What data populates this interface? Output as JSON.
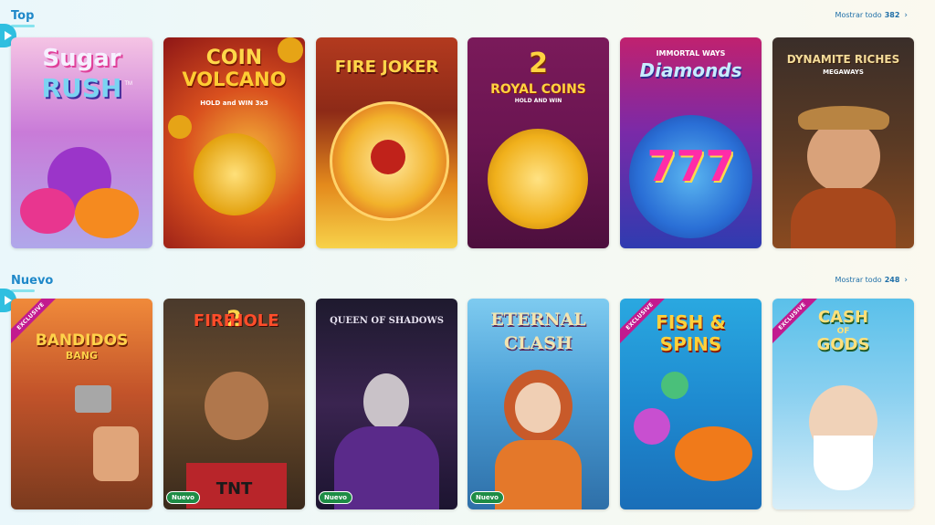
{
  "sections": {
    "top": {
      "title": "Top",
      "show_all_label": "Mostrar todo",
      "count": "382",
      "games": [
        {
          "title1": "Sugar",
          "title2": "RUSH",
          "tm": "TM"
        },
        {
          "title1": "COIN",
          "title2": "VOLCANO",
          "sub": "HOLD and WIN 3x3"
        },
        {
          "title1": "FIRE JOKER"
        },
        {
          "num": "2",
          "title1": "ROYAL COINS",
          "sub": "HOLD AND WIN"
        },
        {
          "title1": "IMMORTAL WAYS",
          "title2": "Diamonds",
          "sevens": "777"
        },
        {
          "title1": "DYNAMITE RICHES",
          "sub": "MEGAWAYS"
        }
      ]
    },
    "new": {
      "title": "Nuevo",
      "show_all_label": "Mostrar todo",
      "count": "248",
      "badge_exclusive": "EXCLUSIVE",
      "badge_new": "Nuevo",
      "games": [
        {
          "title1": "BANDIDOS",
          "title2": "BANG"
        },
        {
          "title1": "FIRE",
          "mid": "2",
          "title2": "HOLE",
          "tnt": "TNT"
        },
        {
          "title1": "QUEEN OF SHADOWS"
        },
        {
          "title1": "ETERNAL",
          "title2": "CLASH"
        },
        {
          "title1": "FISH &",
          "title2": "SPINS"
        },
        {
          "title1": "CASH",
          "mid": "OF",
          "title2": "GODS"
        }
      ]
    }
  },
  "colors": {
    "accent": "#1f88c9",
    "exclusive": "#c21a8f",
    "new": "#1e8c45"
  }
}
